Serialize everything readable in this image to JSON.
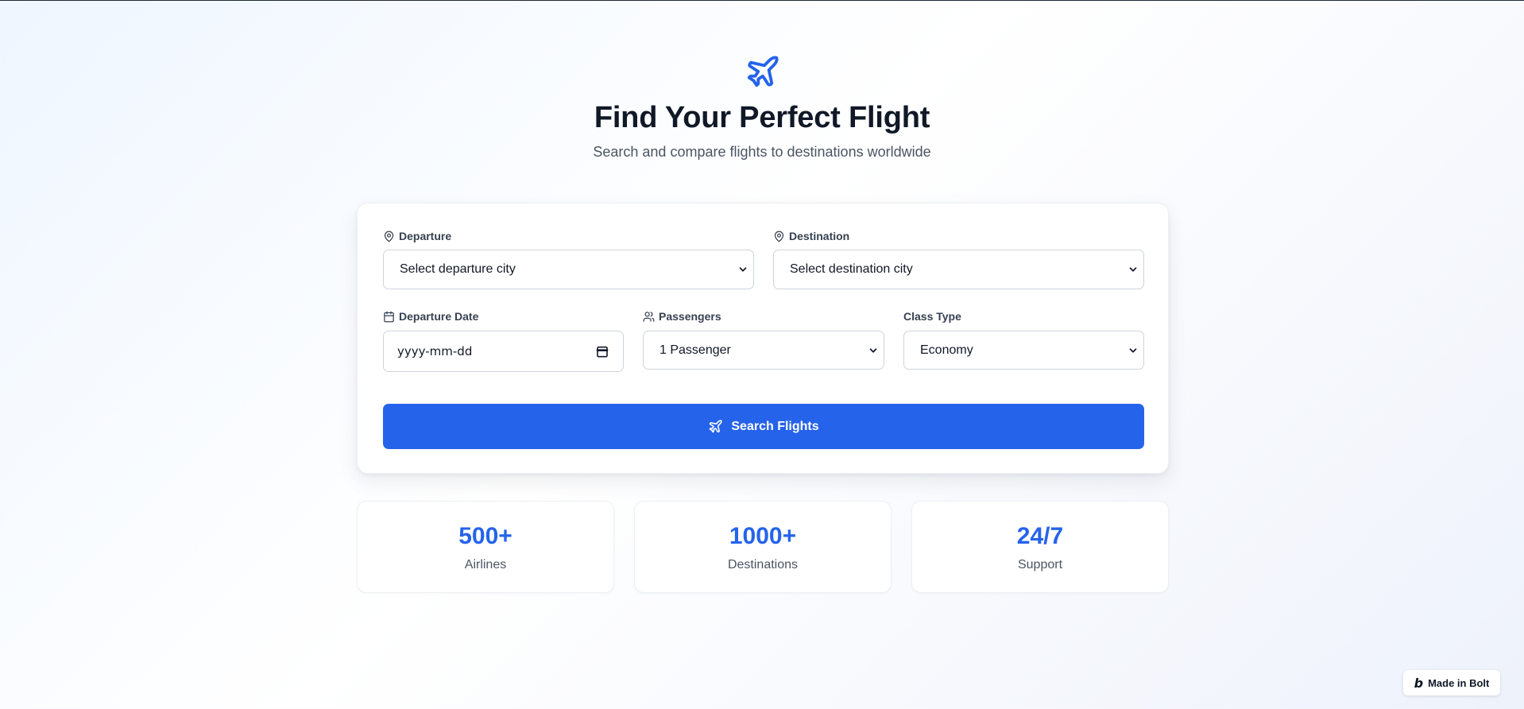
{
  "header": {
    "logo_icon": "plane-icon",
    "title": "Find Your Perfect Flight",
    "subtitle": "Search and compare flights to destinations worldwide"
  },
  "form": {
    "departure": {
      "label": "Departure",
      "icon": "map-pin-icon",
      "value": "Select departure city"
    },
    "destination": {
      "label": "Destination",
      "icon": "map-pin-icon",
      "value": "Select destination city"
    },
    "date": {
      "label": "Departure Date",
      "icon": "calendar-icon",
      "placeholder": "yyyy-mm-dd"
    },
    "passengers": {
      "label": "Passengers",
      "icon": "users-icon",
      "value": "1 Passenger"
    },
    "class_type": {
      "label": "Class Type",
      "value": "Economy"
    },
    "search_button": {
      "label": "Search Flights",
      "icon": "plane-icon"
    }
  },
  "stats": [
    {
      "value": "500+",
      "label": "Airlines"
    },
    {
      "value": "1000+",
      "label": "Destinations"
    },
    {
      "value": "24/7",
      "label": "Support"
    }
  ],
  "badge": {
    "label": "Made in Bolt",
    "icon": "bolt-logo-icon"
  },
  "colors": {
    "accent": "#2563eb",
    "text": "#111827",
    "muted": "#4b5563"
  }
}
